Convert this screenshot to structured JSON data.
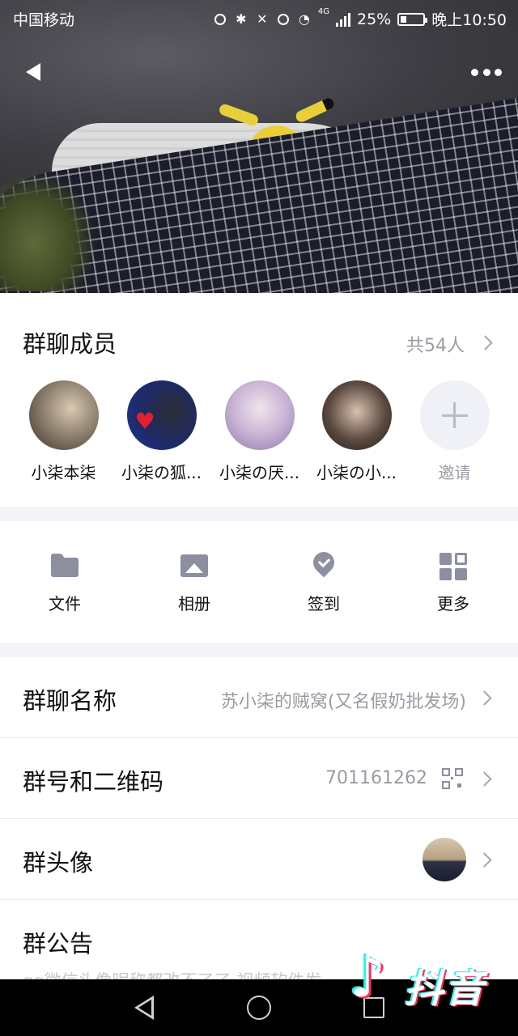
{
  "status_bar": {
    "carrier": "中国移动",
    "network": "4G",
    "battery": "25%",
    "battery_level": 0.25,
    "time": "晚上10:50"
  },
  "header": {
    "back_icon": "back-arrow-icon",
    "more_icon": "more-dots-icon"
  },
  "members": {
    "title": "群聊成员",
    "count": "共54人",
    "list": [
      {
        "name": "小柒本柒"
      },
      {
        "name": "小柒の狐..."
      },
      {
        "name": "小柒の厌..."
      },
      {
        "name": "小柒の小..."
      }
    ],
    "invite_label": "邀请"
  },
  "tools": [
    {
      "label": "文件",
      "icon": "folder-icon"
    },
    {
      "label": "相册",
      "icon": "image-icon"
    },
    {
      "label": "签到",
      "icon": "checkin-icon"
    },
    {
      "label": "更多",
      "icon": "grid-icon"
    }
  ],
  "settings": {
    "group_name_label": "群聊名称",
    "group_name_value": "苏小柒的贼窝(又名假奶批发场)",
    "group_id_label": "群号和二维码",
    "group_id_value": "701161262",
    "group_avatar_label": "群头像",
    "notice_label": "群公告",
    "notice_preview": "qq微信头像昵称都改不了了 视频软件发..."
  },
  "watermark": {
    "text": "抖音"
  }
}
